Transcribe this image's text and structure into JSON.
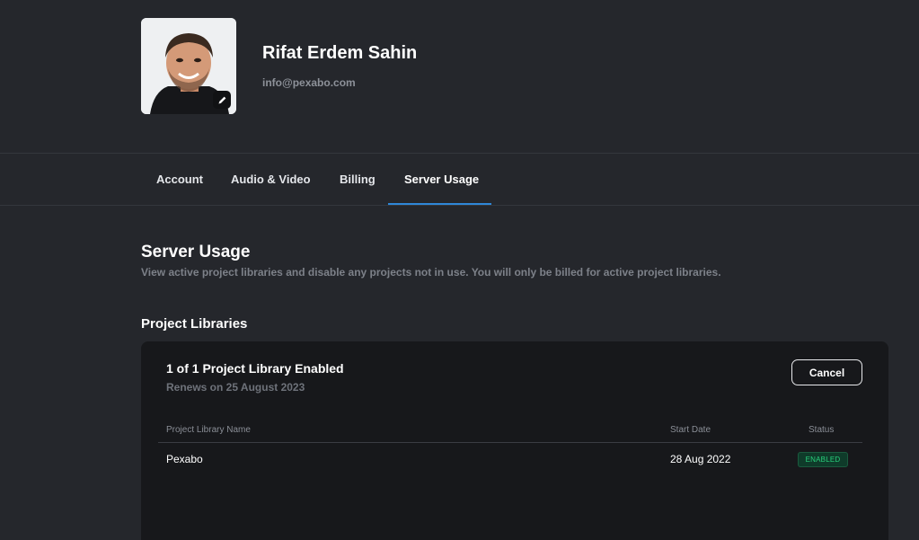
{
  "profile": {
    "name": "Rifat Erdem Sahin",
    "email": "info@pexabo.com"
  },
  "tabs": [
    {
      "label": "Account"
    },
    {
      "label": "Audio & Video"
    },
    {
      "label": "Billing"
    },
    {
      "label": "Server Usage",
      "active": true
    }
  ],
  "section": {
    "title": "Server Usage",
    "description": "View active project libraries and disable any projects not in use. You will only be billed for active project libraries.",
    "subtitle": "Project Libraries"
  },
  "card": {
    "title": "1 of 1 Project Library Enabled",
    "renews": "Renews on 25 August 2023",
    "cancel_label": "Cancel",
    "columns": [
      "Project Library Name",
      "Start Date",
      "Status"
    ],
    "rows": [
      {
        "name": "Pexabo",
        "start_date": "28 Aug 2022",
        "status": "ENABLED"
      }
    ]
  },
  "colors": {
    "background": "#25272c",
    "card": "#17181b",
    "accent": "#2f87d8",
    "status_enabled": "#29d17c"
  },
  "icons": {
    "avatar_edit": "pencil-icon"
  }
}
